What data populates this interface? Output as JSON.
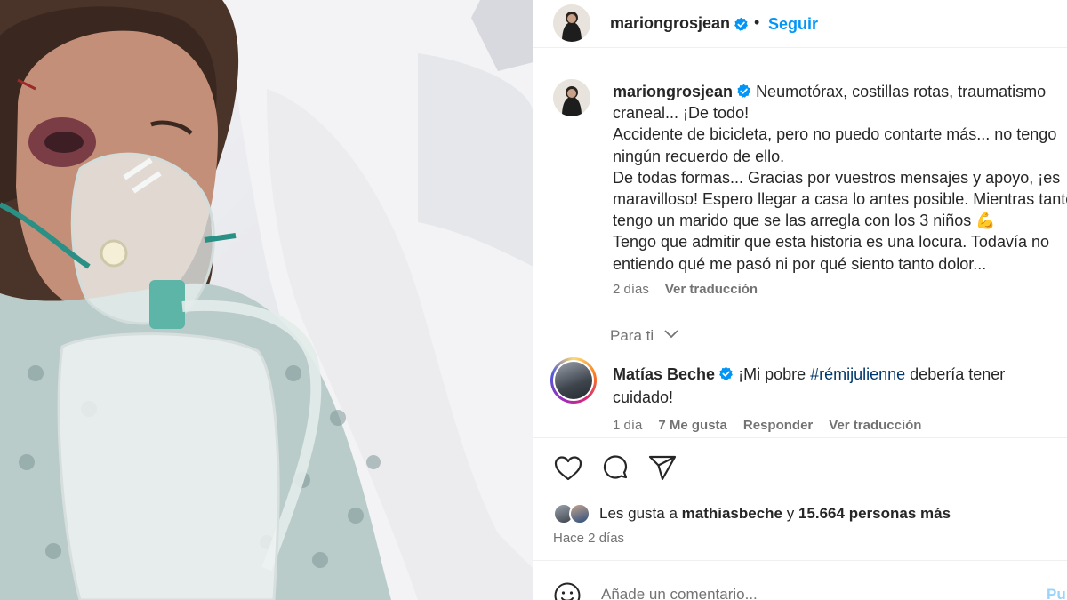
{
  "post": {
    "username": "mariongrosjean",
    "follow_label": "Seguir",
    "dot": "•",
    "caption_lines": [
      "Neumotórax, costillas rotas, traumatismo",
      "craneal... ¡De todo!",
      "Accidente de bicicleta, pero no puedo contarte más... no tengo",
      "ningún recuerdo de ello.",
      "De todas formas... Gracias por vuestros mensajes y apoyo, ¡es",
      "maravilloso! Espero llegar a casa lo antes posible. Mientras tanto",
      "tengo un marido que se las arregla con los 3 niños 💪",
      "Tengo que admitir que esta historia es una locura. Todavía no",
      "entiendo qué me pasó ni por qué siento tanto dolor..."
    ],
    "caption_age": "2 días",
    "caption_translate": "Ver traducción"
  },
  "for_you": {
    "label": "Para ti"
  },
  "comment": {
    "username": "Matías Beche",
    "text_before": "¡Mi pobre ",
    "hashtag": "#rémijulienne",
    "text_after_line1": " debería tener",
    "text_line2": "cuidado!",
    "age": "1 día",
    "likes": "7 Me gusta",
    "reply": "Responder",
    "translate": "Ver traducción"
  },
  "actions": {
    "like_icon": "heart-icon",
    "comment_icon": "comment-bubble-icon",
    "share_icon": "paper-plane-icon"
  },
  "likes": {
    "prefix": "Les gusta a ",
    "user": "mathiasbeche",
    "middle": " y ",
    "count": "15.664 personas más"
  },
  "timestamp": "Hace 2 días",
  "comment_input": {
    "placeholder": "Añade un comentario...",
    "publish": "Pu"
  },
  "colors": {
    "link_blue": "#0095f6",
    "hashtag": "#00376b",
    "secondary_text": "#737373",
    "verified": "#0095f6"
  }
}
